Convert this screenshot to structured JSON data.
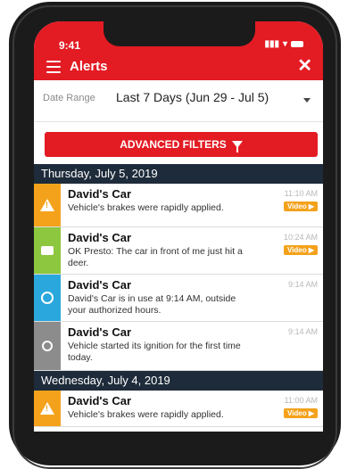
{
  "status_bar": {
    "time": "9:41",
    "signal": "▮▮▮",
    "wifi": "▾"
  },
  "header": {
    "title": "Alerts",
    "close": "✕"
  },
  "filter": {
    "date_label": "Date Range",
    "date_value": "Last 7 Days (Jun 29 - Jul 5)"
  },
  "advanced_filters_label": "ADVANCED FILTERS",
  "days": [
    {
      "label": "Thursday, July 5, 2019"
    },
    {
      "label": "Wednesday, July 4, 2019"
    }
  ],
  "alerts": [
    {
      "title": "David's Car",
      "message": "Vehicle's brakes were rapidly applied.",
      "time": "11:10 AM",
      "video": "Video ▶",
      "color": "#f4a21b",
      "icon": "warning-icon"
    },
    {
      "title": "David's Car",
      "message": "OK Presto: The car in front of me just hit a deer.",
      "time": "10:24 AM",
      "video": "Video ▶",
      "color": "#8dc63f",
      "icon": "dashcam-icon"
    },
    {
      "title": "David's Car",
      "message": "David's Car is in use at 9:14 AM, outside your authorized hours.",
      "time": "9:14 AM",
      "color": "#2aa7dc",
      "icon": "clock-icon"
    },
    {
      "title": "David's Car",
      "message": "Vehicle started its ignition for the first time today.",
      "time": "9:14 AM",
      "color": "#8c8c8c",
      "icon": "key-icon"
    },
    {
      "title": "David's Car",
      "message": "Vehicle's brakes were rapidly applied.",
      "time": "11:00 AM",
      "video": "Video ▶",
      "color": "#f4a21b",
      "icon": "warning-icon"
    }
  ]
}
